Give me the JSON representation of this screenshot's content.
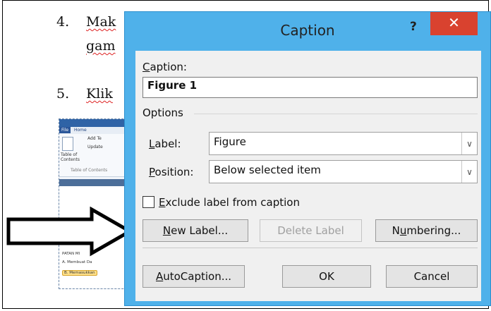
{
  "document": {
    "step4_num": "4.",
    "step4_text_l1": "Mak",
    "step4_text_l2": "gam",
    "step5_num": "5.",
    "step5_text": "Klik",
    "screenshot": {
      "tab_file": "File",
      "tab_home": "Home",
      "add_text": "Add Te",
      "update": "Update",
      "toc_l1": "Table of",
      "toc_l2": "Contents",
      "toc_group": "Table of Contents",
      "nav_item1": "PATAN MI",
      "nav_item2": "A. Membuat Da",
      "nav_item3": "B. Memasukkan"
    }
  },
  "dialog": {
    "title": "Caption",
    "help_glyph": "?",
    "close_glyph": "✕",
    "caption_label": "Caption:",
    "caption_label_mnemonic": "C",
    "caption_label_rest": "aption:",
    "caption_value": "Figure 1",
    "options_group": "Options",
    "label_field": {
      "mnemonic": "L",
      "rest": "abel:",
      "value": "Figure"
    },
    "position_field": {
      "mnemonic": "P",
      "rest": "osition:",
      "value": "Below selected item"
    },
    "exclude_checkbox": {
      "mnemonic": "E",
      "rest": "xclude label from caption",
      "checked": false
    },
    "buttons": {
      "new_label": {
        "mnemonic": "N",
        "rest": "ew Label..."
      },
      "delete_label": "Delete Label",
      "numbering": {
        "pre": "N",
        "mnemonic": "u",
        "rest": "mbering..."
      },
      "autocaption": {
        "mnemonic": "A",
        "rest": "utoCaption..."
      },
      "ok": "OK",
      "cancel": "Cancel"
    }
  },
  "colors": {
    "frame": "#4fb1ea",
    "close": "#d9422f",
    "client": "#f0f0f0"
  }
}
